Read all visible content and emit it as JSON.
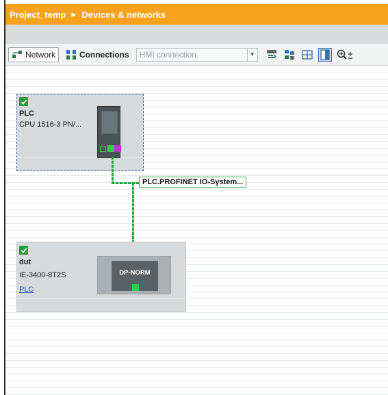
{
  "breadcrumb": {
    "project": "Project_temp",
    "section": "Devices & networks"
  },
  "toolbar": {
    "network_label": "Network",
    "connections_label": "Connections",
    "connection_type": {
      "selected": "HMI connection"
    },
    "icons": [
      "network-icon",
      "connections-icon",
      "chevron-down-icon",
      "address-icon",
      "network-overview-icon",
      "table-icon",
      "page-view-icon",
      "zoom-icon"
    ]
  },
  "devices": [
    {
      "name": "PLC",
      "type": "CPU 1516-3 PN/...",
      "checked": true,
      "selected": true
    },
    {
      "name": "dut",
      "type": "IE-3400-8T2S",
      "controller_link": "PLC",
      "module_label": "DP-NORM",
      "checked": true
    }
  ],
  "network": {
    "label": "PLC.PROFINET IO-System..."
  },
  "colors": {
    "title_bar": "#f7a21b",
    "profinet_line": "#1ca640",
    "selection": "#3e66b5",
    "link": "#1f4fb8"
  }
}
